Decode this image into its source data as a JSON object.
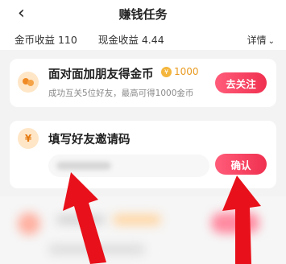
{
  "header": {
    "title": "赚钱任务"
  },
  "stats": {
    "coin_income": "金币收益 110",
    "cash_income": "现金收益 4.44",
    "details_label": "详情"
  },
  "task_card": {
    "title": "面对面加朋友得金币",
    "reward": "1000",
    "subtitle": "成功互关5位好友，最高可得1000金币",
    "button_label": "去关注"
  },
  "invite_card": {
    "title": "填写好友邀请码",
    "input_placeholder": "",
    "button_label": "确认"
  },
  "colors": {
    "accent": "#f0304f",
    "coin": "#f4b63d",
    "arrow": "#e8101a"
  },
  "icons": {
    "back": "back-chevron-icon",
    "friends": "add-friends-icon",
    "coin": "coin-icon",
    "invite": "yen-coin-icon"
  }
}
